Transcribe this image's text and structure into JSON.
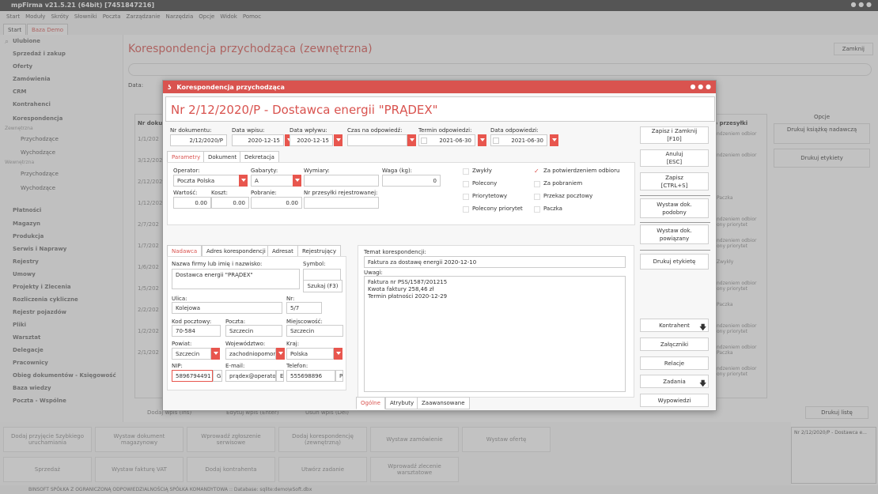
{
  "app": {
    "title": "mpFirma v21.5.21 (64bit) [7451847216]",
    "menu": [
      "Start",
      "Moduły",
      "Skróty",
      "Słowniki",
      "Poczta",
      "Zarządzanie",
      "Narzędzia",
      "Opcje",
      "Widok",
      "Pomoc"
    ],
    "tabs": [
      "Start",
      "Baza Demo"
    ]
  },
  "sidebar": {
    "items": [
      "Ulubione",
      "Sprzedaż i zakup",
      "Oferty",
      "Zamówienia",
      "CRM",
      "Kontrahenci",
      "Korespondencja",
      "Zewnętrzna",
      "Przychodzące",
      "Wychodzące",
      "Wewnętrzna",
      "Przychodzące",
      "Wychodzące",
      "Płatności",
      "Magazyn",
      "Produkcja",
      "Serwis i Naprawy",
      "Rejestry",
      "Umowy",
      "Projekty i Zlecenia",
      "Rozliczenia cykliczne",
      "Rejestr pojazdów",
      "Pliki",
      "Warsztat",
      "Delegacje",
      "Pracownicy",
      "Obieg dokumentów - Księgowość",
      "Baza wiedzy",
      "Poczta - Wspólne"
    ]
  },
  "bg": {
    "title": "Korespondencja przychodząca (zewnętrzna)",
    "close": "Zamknij",
    "data_label": "Data:",
    "col_nr": "Nr dokum",
    "col_opcje": "Opcje",
    "col_sposob": "b przesyłki",
    "dates": [
      "1/1/202",
      "3/12/202",
      "2/12/202",
      "1/12/202",
      "2/7/202",
      "1/7/202",
      "1/6/202",
      "1/5/202",
      "2/2/202",
      "1/2/202",
      "2/1/202"
    ],
    "sposob": [
      "ndzeniem odbior",
      "ndzeniem odbior",
      "",
      "Paczka",
      "ndzeniem odbior\nony priorytet",
      "ndzeniem odbior\nony priorytet",
      "Zwykły",
      "ndzeniem odbior\nony priorytet",
      "Paczka",
      "ndzeniem odbior\nony priorytet",
      "ndzeniem odbior\nPaczka",
      "ndzeniem odbior\nony priorytet"
    ],
    "opcje": [
      "Drukuj książkę nadawczą",
      "Drukuj etykiety"
    ],
    "bottom_btns": [
      "Dodaj wpis (Ins)",
      "Edytuj wpis (Enter)",
      "Usuń wpis (Del)"
    ],
    "drukuj_liste": "Drukuj listę",
    "thumb": "Nr 2/12/2020/P - Dostawca e...",
    "quick": [
      "Dodaj przyjęcie Szybkiego uruchamiania",
      "Wystaw dokument magazynowy",
      "Wprowadź zgłoszenie serwisowe",
      "Dodaj korespondencję (zewnętrzną)",
      "Wystaw zamówienie",
      "Wystaw ofertę",
      "Sprzedaż",
      "Wystaw fakturę VAT",
      "Dodaj kontrahenta",
      "Utwórz zadanie",
      "Wprowadź zlecenie warsztatowe"
    ],
    "status": "BINSOFT SPÓŁKA Z OGRANICZONĄ ODPOWIEDZIALNOŚCIĄ SPÓŁKA KOMANDYTOWA :: Database: sqlite:demo\\eSoft.dbx"
  },
  "dialog": {
    "title": "Korespondencja przychodząca",
    "heading": "Nr 2/12/2020/P - Dostawca energii \"PRĄDEX\"",
    "labels": {
      "nr": "Nr dokumentu:",
      "data_wpisu": "Data wpisu:",
      "data_wplywu": "Data wpływu:",
      "czas": "Czas na odpowiedź:",
      "termin": "Termin odpowiedzi:",
      "data_odp": "Data odpowiedzi:"
    },
    "values": {
      "nr": "2/12/2020/P",
      "data_wpisu": "2020-12-15",
      "data_wplywu": "2020-12-15",
      "termin": "2021-06-30",
      "data_odp": "2021-06-30"
    },
    "tabs": [
      "Parametry",
      "Dokument",
      "Dekretacja"
    ],
    "param": {
      "operator_l": "Operator:",
      "operator": "Poczta Polska",
      "gabaryty_l": "Gabaryty:",
      "gabaryty": "A",
      "wymiary_l": "Wymiary:",
      "waga_l": "Waga (kg):",
      "waga": "0",
      "wartosc_l": "Wartość:",
      "wartosc": "0.00",
      "koszt_l": "Koszt:",
      "koszt": "0.00",
      "pobranie_l": "Pobranie:",
      "pobranie": "0.00",
      "nrprz_l": "Nr przesyłki rejestrowanej:"
    },
    "checks": [
      "Zwykły",
      "Polecony",
      "Priorytetowy",
      "Polecony priorytet",
      "Za potwierdzeniem odbioru",
      "Za pobraniem",
      "Przekaz pocztowy",
      "Paczka"
    ],
    "subtabs": [
      "Nadawca",
      "Adres korespondencji",
      "Adresat",
      "Rejestrujący"
    ],
    "nadawca": {
      "nazwa_l": "Nazwa firmy lub imię i nazwisko:",
      "nazwa": "Dostawca energii \"PRĄDEX\"",
      "symbol_l": "Symbol:",
      "szukaj": "Szukaj (F3)",
      "ulica_l": "Ulica:",
      "ulica": "Kolejowa",
      "nr_l": "Nr:",
      "nr": "5/7",
      "kod_l": "Kod pocztowy:",
      "kod": "70-584",
      "poczta_l": "Poczta:",
      "poczta": "Szczecin",
      "miejsc_l": "Miejscowość:",
      "miejsc": "Szczecin",
      "powiat_l": "Powiat:",
      "powiat": "Szczecin",
      "woj_l": "Województwo:",
      "woj": "zachodniopomor",
      "kraj_l": "Kraj:",
      "kraj": "Polska",
      "nip_l": "NIP:",
      "nip": "5896794491",
      "nip_g": "G",
      "email_l": "E-mail:",
      "email": "prądex@operator",
      "email_e": "E",
      "tel_l": "Telefon:",
      "tel": "555698896",
      "tel_p": "P"
    },
    "temat_l": "Temat korespondencji:",
    "temat": "Faktura za dostawę energii 2020-12-10",
    "uwagi_l": "Uwagi:",
    "uwagi": [
      "Faktura nr PSS/1587/201215",
      "Kwota faktury 258,46 zł",
      "Termin płatności 2020-12-29"
    ],
    "bottomtabs": [
      "Ogólne",
      "Atrybuty",
      "Zaawansowane"
    ],
    "buttons": [
      "Zapisz i Zamknij\n[F10]",
      "Anuluj\n[ESC]",
      "Zapisz\n[CTRL+S]",
      "Wystaw dok.\npodobny",
      "Wystaw dok.\npowiązany",
      "Drukuj etykietę",
      "Kontrahent",
      "Załączniki",
      "Relacje",
      "Zadania",
      "Wypowiedzi"
    ]
  }
}
